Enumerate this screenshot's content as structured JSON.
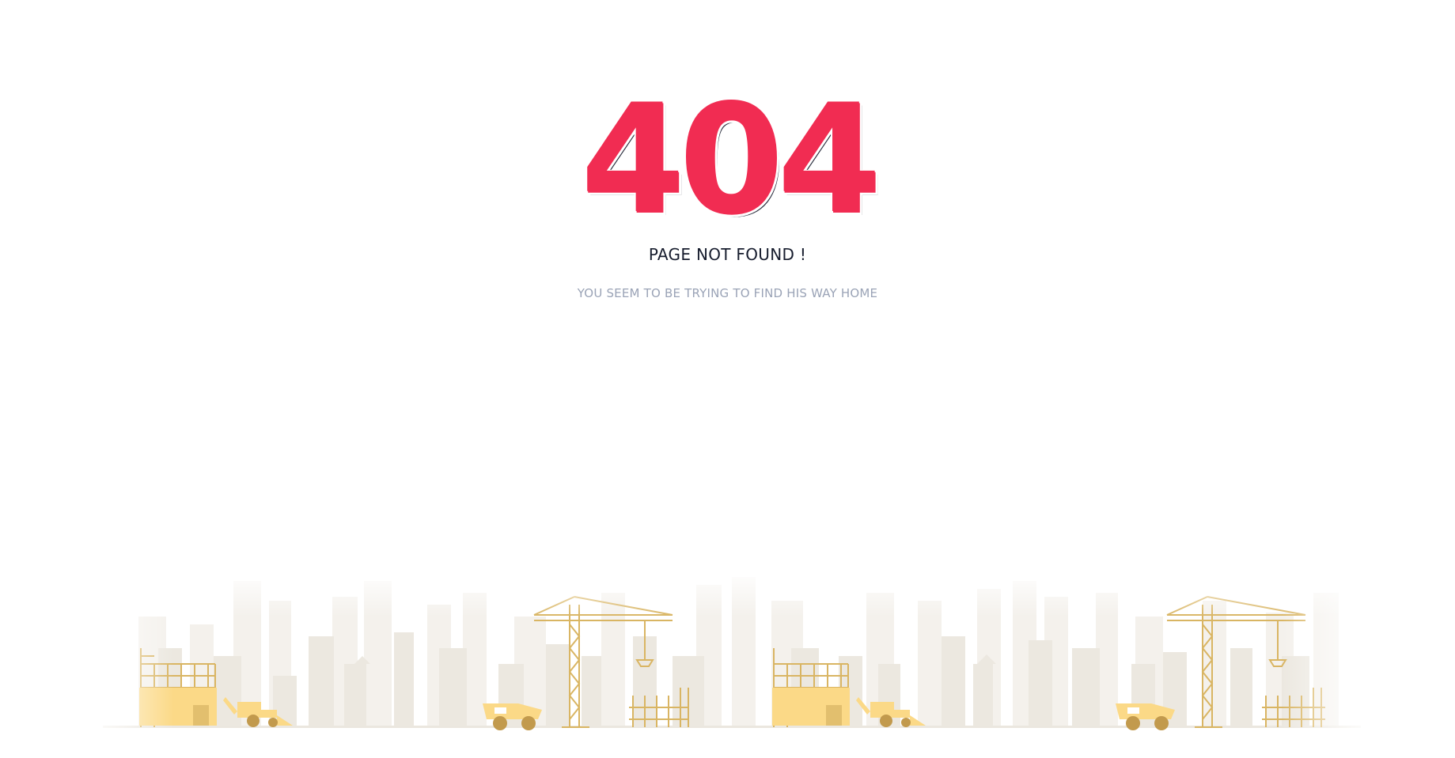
{
  "error": {
    "code": "404",
    "title": "PAGE NOT FOUND !",
    "subtitle": "YOU SEEM TO BE TRYING TO FIND HIS WAY HOME"
  },
  "colors": {
    "code_fill": "#f12c52",
    "code_shadow": "#2b2f3f",
    "title": "#161c2d",
    "subtitle": "#9aa3b6",
    "buildings": "#ece8e0",
    "buildings_light": "#f4f1ec",
    "construction": "#d9b563",
    "construction_fill": "#fbd987"
  },
  "illustration": {
    "name": "construction-skyline"
  }
}
